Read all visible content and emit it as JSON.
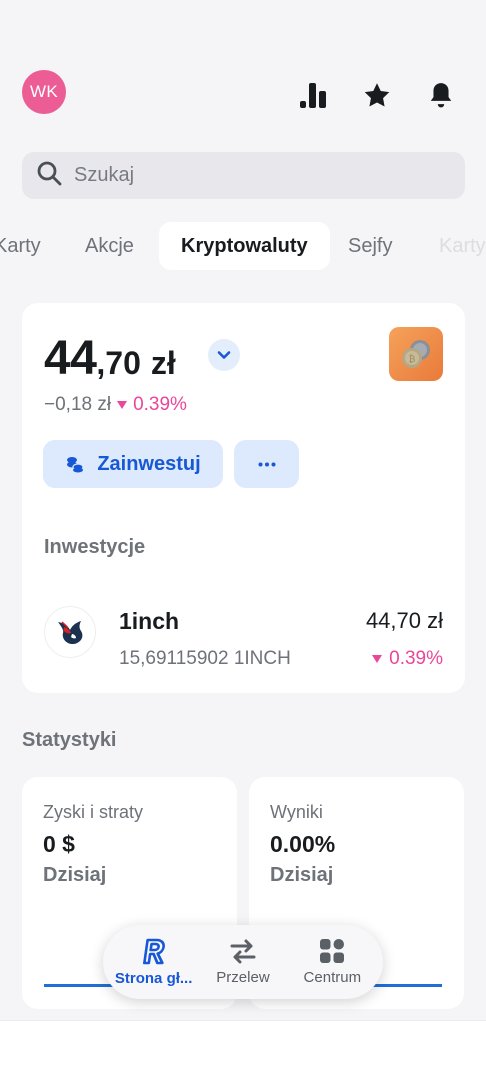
{
  "header": {
    "avatar_initials": "WK",
    "icons": [
      "chart-icon",
      "star-icon",
      "bell-icon"
    ]
  },
  "search": {
    "placeholder": "Szukaj"
  },
  "tabs": [
    {
      "label": "Karty",
      "state": "partial"
    },
    {
      "label": "Akcje",
      "state": "normal"
    },
    {
      "label": "Kryptowaluty",
      "state": "active"
    },
    {
      "label": "Sejfy",
      "state": "normal"
    },
    {
      "label": "Karty",
      "state": "faded"
    }
  ],
  "portfolio": {
    "balance_int": "44",
    "balance_dec": ",70",
    "currency": "zł",
    "change_amount": "−0,18 zł",
    "change_pct": "0.39%",
    "invest_label": "Zainwestuj",
    "more_label": "···"
  },
  "investments": {
    "title": "Inwestycje",
    "items": [
      {
        "name": "1inch",
        "quantity": "15,69115902 1INCH",
        "value": "44,70 zł",
        "change_pct": "0.39%"
      }
    ]
  },
  "stats": {
    "title": "Statystyki",
    "cards": [
      {
        "label": "Zyski i straty",
        "value": "0 $",
        "period": "Dzisiaj"
      },
      {
        "label": "Wyniki",
        "value": "0.00%",
        "period": "Dzisiaj"
      }
    ]
  },
  "nav": [
    {
      "label": "Strona gł...",
      "active": true
    },
    {
      "label": "Przelew",
      "active": false
    },
    {
      "label": "Centrum",
      "active": false
    }
  ],
  "colors": {
    "accent": "#1758d6",
    "negative": "#e8479a",
    "avatar": "#ec5c95",
    "background": "#f5f5f7"
  }
}
